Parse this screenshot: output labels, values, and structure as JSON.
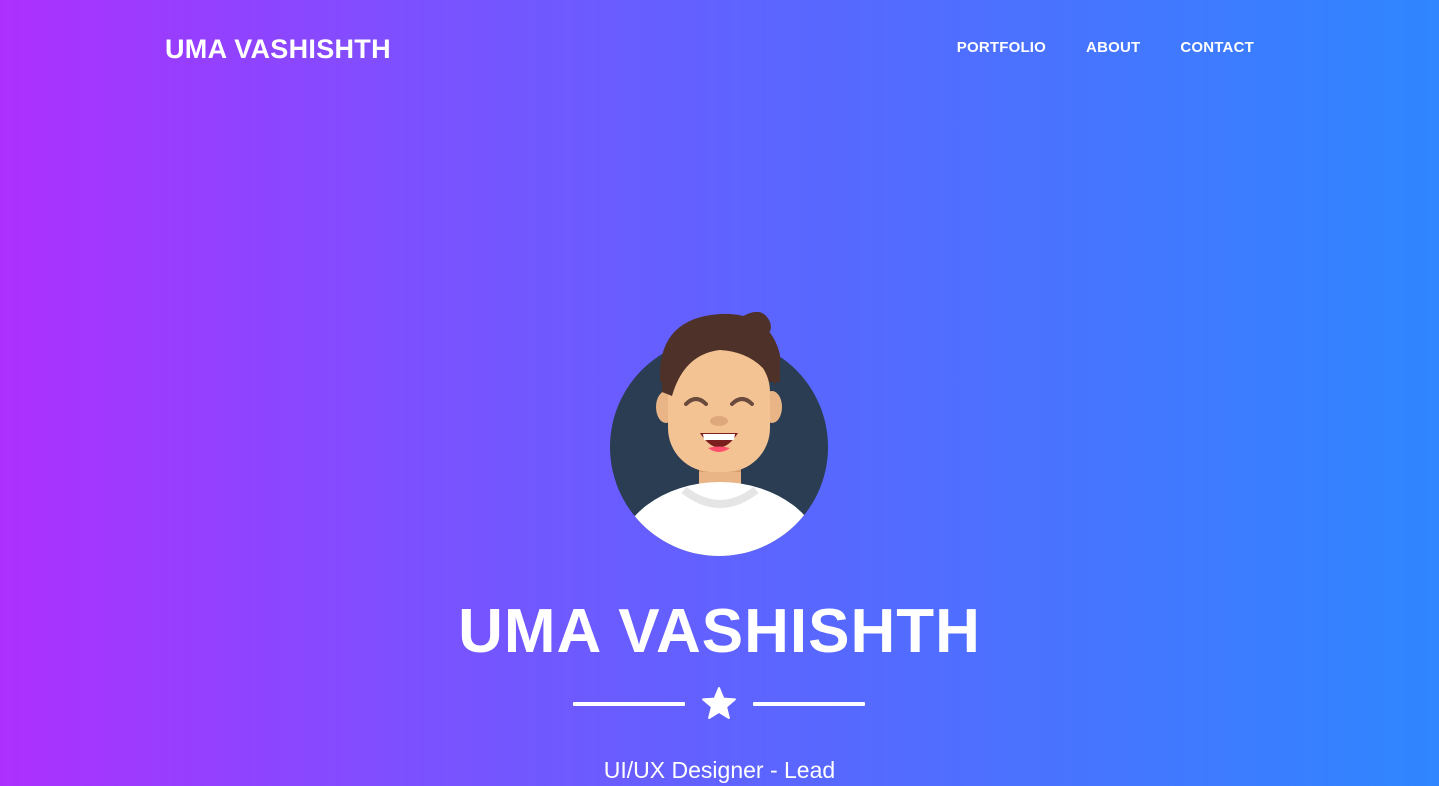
{
  "nav": {
    "brand": "UMA VASHISHTH",
    "links": [
      {
        "label": "PORTFOLIO"
      },
      {
        "label": "ABOUT"
      },
      {
        "label": "CONTACT"
      }
    ]
  },
  "hero": {
    "name": "UMA VASHISHTH",
    "divider_icon": "star-icon",
    "subtitle": "UI/UX Designer - Lead",
    "avatar_icon": "avatar"
  },
  "colors": {
    "gradient_start": "#ad2ffe",
    "gradient_end": "#2f86ff",
    "avatar_background": "#2a3d52",
    "text": "#ffffff"
  }
}
